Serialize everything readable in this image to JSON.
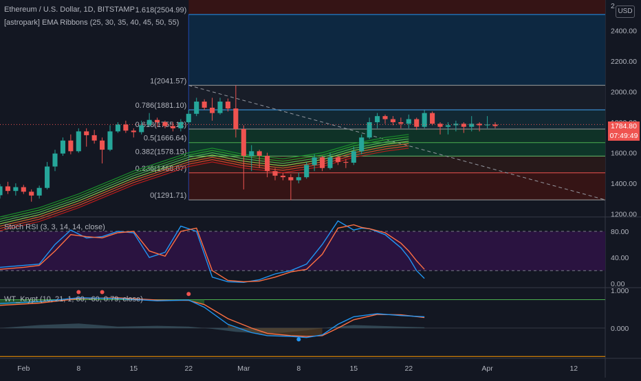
{
  "header": {
    "symbol_line": "Ethereum / U.S. Dollar, 1D, BITSTAMP",
    "ribbon_line": "[astropark] EMA Ribbons (25, 30, 35, 40, 45, 50, 55)",
    "stoch_line": "Stoch RSI (3, 3, 14, 14, close)",
    "wt_line": "WT_Krypt (10, 21, 1, 60, -60, 0.79, close)",
    "currency_button": "USD",
    "price_tag": "1784.80",
    "countdown_tag": "07:49:49",
    "top_partial_tick": "2"
  },
  "colors": {
    "bg": "#131722",
    "up": "#26a69a",
    "down": "#ef5350",
    "price_tag_bg": "#ef5350",
    "fib_border": "#2962ff",
    "stoch_k": "#2196f3",
    "stoch_d": "#ff7043",
    "stoch_band_fill": "#2a1340"
  },
  "chart_data": [
    {
      "type": "candlestick",
      "title": "Ethereum / U.S. Dollar, 1D, BITSTAMP",
      "ylim": [
        1180,
        2600
      ],
      "y_ticks": [
        "2400.00",
        "2200.00",
        "2000.00",
        "1800.00",
        "1600.00",
        "1400.00",
        "1200.00"
      ],
      "y_tick_values": [
        2400,
        2200,
        2000,
        1800,
        1600,
        1400,
        1200
      ],
      "x_ticks": [
        "Feb",
        "8",
        "15",
        "22",
        "Mar",
        "8",
        "15",
        "22",
        "Apr",
        "12"
      ],
      "x_tick_days": [
        0,
        7,
        14,
        21,
        28,
        35,
        42,
        49,
        59,
        70
      ],
      "x_range_days": [
        -3,
        74
      ],
      "candles_start_day": -3,
      "candles": [
        [
          1322,
          1380,
          1300,
          1395
        ],
        [
          1380,
          1350,
          1330,
          1410
        ],
        [
          1350,
          1375,
          1320,
          1400
        ],
        [
          1375,
          1345,
          1330,
          1390
        ],
        [
          1345,
          1320,
          1280,
          1360
        ],
        [
          1320,
          1370,
          1300,
          1385
        ],
        [
          1370,
          1510,
          1360,
          1540
        ],
        [
          1510,
          1595,
          1480,
          1620
        ],
        [
          1595,
          1680,
          1580,
          1700
        ],
        [
          1680,
          1610,
          1590,
          1720
        ],
        [
          1610,
          1740,
          1600,
          1760
        ],
        [
          1740,
          1715,
          1640,
          1760
        ],
        [
          1715,
          1680,
          1660,
          1750
        ],
        [
          1680,
          1620,
          1530,
          1700
        ],
        [
          1620,
          1740,
          1610,
          1780
        ],
        [
          1740,
          1785,
          1730,
          1800
        ],
        [
          1785,
          1745,
          1730,
          1810
        ],
        [
          1745,
          1735,
          1700,
          1760
        ],
        [
          1735,
          1780,
          1720,
          1810
        ],
        [
          1780,
          1815,
          1770,
          1860
        ],
        [
          1815,
          1800,
          1770,
          1830
        ],
        [
          1800,
          1775,
          1760,
          1810
        ],
        [
          1775,
          1760,
          1740,
          1800
        ],
        [
          1760,
          1800,
          1740,
          1820
        ],
        [
          1800,
          1855,
          1790,
          1880
        ],
        [
          1855,
          1935,
          1840,
          1960
        ],
        [
          1935,
          1895,
          1880,
          1950
        ],
        [
          1895,
          1860,
          1810,
          1960
        ],
        [
          1860,
          1935,
          1850,
          1960
        ],
        [
          1935,
          1890,
          1870,
          1955
        ],
        [
          1890,
          1755,
          1700,
          2041
        ],
        [
          1755,
          1580,
          1360,
          1780
        ],
        [
          1580,
          1610,
          1480,
          1650
        ],
        [
          1610,
          1580,
          1500,
          1620
        ],
        [
          1580,
          1480,
          1440,
          1600
        ],
        [
          1480,
          1450,
          1420,
          1500
        ],
        [
          1450,
          1440,
          1420,
          1470
        ],
        [
          1440,
          1420,
          1290,
          1460
        ],
        [
          1420,
          1440,
          1400,
          1470
        ],
        [
          1440,
          1520,
          1430,
          1540
        ],
        [
          1520,
          1570,
          1480,
          1590
        ],
        [
          1570,
          1500,
          1480,
          1580
        ],
        [
          1500,
          1570,
          1490,
          1600
        ],
        [
          1570,
          1540,
          1520,
          1580
        ],
        [
          1540,
          1535,
          1500,
          1560
        ],
        [
          1535,
          1610,
          1520,
          1640
        ],
        [
          1610,
          1700,
          1590,
          1720
        ],
        [
          1700,
          1800,
          1690,
          1830
        ],
        [
          1800,
          1840,
          1760,
          1860
        ],
        [
          1840,
          1820,
          1790,
          1850
        ],
        [
          1820,
          1800,
          1780,
          1840
        ],
        [
          1800,
          1790,
          1760,
          1830
        ],
        [
          1790,
          1820,
          1760,
          1850
        ],
        [
          1820,
          1770,
          1750,
          1830
        ],
        [
          1770,
          1860,
          1760,
          1880
        ],
        [
          1860,
          1790,
          1780,
          1870
        ],
        [
          1790,
          1770,
          1720,
          1800
        ],
        [
          1770,
          1780,
          1720,
          1800
        ],
        [
          1780,
          1790,
          1740,
          1810
        ],
        [
          1790,
          1770,
          1730,
          1800
        ],
        [
          1770,
          1790,
          1740,
          1840
        ],
        [
          1790,
          1780,
          1740,
          1800
        ],
        [
          1780,
          1785,
          1760,
          1840
        ],
        [
          1785,
          1775,
          1760,
          1800
        ]
      ],
      "candle_columns": [
        "open",
        "close",
        "low",
        "high"
      ],
      "current_price": 1784.8,
      "fib_levels": [
        {
          "ratio": "1.618",
          "value": 2504.99,
          "label": "1.618(2504.99)"
        },
        {
          "ratio": "1",
          "value": 2041.57,
          "label": "1(2041.57)"
        },
        {
          "ratio": "0.786",
          "value": 1881.1,
          "label": "0.786(1881.10)"
        },
        {
          "ratio": "0.618",
          "value": 1755.12,
          "label": "0.618(1755.12)"
        },
        {
          "ratio": "0.5",
          "value": 1666.64,
          "label": "0.5(1666.64)"
        },
        {
          "ratio": "0.382",
          "value": 1578.15,
          "label": "0.382(1578.15)"
        },
        {
          "ratio": "0.236",
          "value": 1468.67,
          "label": "0.236(1468.67)"
        },
        {
          "ratio": "0",
          "value": 1291.71,
          "label": "0(1291.71)"
        }
      ],
      "fib_range_days": [
        21,
        74
      ],
      "trendline": {
        "from": [
          21,
          2041.57
        ],
        "to": [
          74,
          1291.71
        ]
      },
      "ema_ribbon_basis": [
        [
          -3,
          1180
        ],
        [
          2,
          1240
        ],
        [
          7,
          1330
        ],
        [
          14,
          1480
        ],
        [
          21,
          1600
        ],
        [
          24,
          1630
        ],
        [
          28,
          1590
        ],
        [
          33,
          1560
        ],
        [
          38,
          1600
        ],
        [
          42,
          1660
        ],
        [
          46,
          1700
        ],
        [
          49,
          1720
        ]
      ],
      "ema_offsets": [
        0,
        -15,
        -30,
        -45,
        -60,
        -75,
        -90
      ],
      "ema_colors": [
        "#1b8e2d",
        "#2ca02c",
        "#4caf50",
        "#8bc34a",
        "#c8652b",
        "#d4442b",
        "#b71c1c"
      ]
    },
    {
      "type": "line",
      "title": "Stoch RSI (3, 3, 14, 14, close)",
      "ylim": [
        -5,
        100
      ],
      "y_ticks": [
        "80.00",
        "40.00",
        "0.00"
      ],
      "y_tick_values": [
        80,
        40,
        0
      ],
      "band": [
        20,
        80
      ],
      "series": [
        {
          "name": "K",
          "color": "#2196f3",
          "points": [
            [
              -3,
              25
            ],
            [
              0,
              28
            ],
            [
              2,
              30
            ],
            [
              4,
              60
            ],
            [
              6,
              82
            ],
            [
              8,
              70
            ],
            [
              10,
              72
            ],
            [
              12,
              80
            ],
            [
              14,
              78
            ],
            [
              16,
              40
            ],
            [
              18,
              48
            ],
            [
              20,
              88
            ],
            [
              22,
              80
            ],
            [
              24,
              10
            ],
            [
              26,
              3
            ],
            [
              28,
              2
            ],
            [
              30,
              6
            ],
            [
              32,
              15
            ],
            [
              34,
              20
            ],
            [
              36,
              30
            ],
            [
              38,
              60
            ],
            [
              40,
              96
            ],
            [
              42,
              82
            ],
            [
              43,
              85
            ],
            [
              44,
              84
            ],
            [
              46,
              75
            ],
            [
              48,
              55
            ],
            [
              49,
              40
            ],
            [
              50,
              20
            ],
            [
              51,
              8
            ]
          ]
        },
        {
          "name": "D",
          "color": "#ff7043",
          "points": [
            [
              -3,
              22
            ],
            [
              0,
              25
            ],
            [
              2,
              28
            ],
            [
              4,
              50
            ],
            [
              6,
              75
            ],
            [
              8,
              72
            ],
            [
              10,
              70
            ],
            [
              12,
              78
            ],
            [
              14,
              80
            ],
            [
              16,
              50
            ],
            [
              18,
              42
            ],
            [
              20,
              80
            ],
            [
              22,
              85
            ],
            [
              24,
              20
            ],
            [
              26,
              5
            ],
            [
              28,
              3
            ],
            [
              30,
              4
            ],
            [
              32,
              10
            ],
            [
              34,
              18
            ],
            [
              36,
              22
            ],
            [
              38,
              45
            ],
            [
              40,
              85
            ],
            [
              42,
              90
            ],
            [
              43,
              86
            ],
            [
              44,
              84
            ],
            [
              46,
              78
            ],
            [
              48,
              62
            ],
            [
              49,
              50
            ],
            [
              50,
              35
            ],
            [
              51,
              22
            ]
          ]
        }
      ]
    },
    {
      "type": "line",
      "title": "WT_Krypt (10, 21, 1, 60, -60, 0.79, close)",
      "ylim": [
        -0.8,
        1.05
      ],
      "y_ticks": [
        "1.000",
        "0.000"
      ],
      "y_tick_values": [
        1,
        0
      ],
      "levels": [
        0.75,
        -0.75
      ],
      "series": [
        {
          "name": "wt1",
          "color": "#2196f3",
          "points": [
            [
              -3,
              0.65
            ],
            [
              2,
              0.7
            ],
            [
              7,
              0.8
            ],
            [
              12,
              0.78
            ],
            [
              17,
              0.72
            ],
            [
              21,
              0.74
            ],
            [
              23,
              0.55
            ],
            [
              26,
              0.1
            ],
            [
              29,
              -0.12
            ],
            [
              31,
              -0.2
            ],
            [
              34,
              -0.22
            ],
            [
              36,
              -0.25
            ],
            [
              38,
              -0.18
            ],
            [
              40,
              0.1
            ],
            [
              42,
              0.3
            ],
            [
              45,
              0.38
            ],
            [
              48,
              0.33
            ],
            [
              51,
              0.3
            ]
          ]
        },
        {
          "name": "wt2",
          "color": "#ff7043",
          "points": [
            [
              -3,
              0.6
            ],
            [
              2,
              0.66
            ],
            [
              7,
              0.78
            ],
            [
              12,
              0.8
            ],
            [
              17,
              0.74
            ],
            [
              21,
              0.73
            ],
            [
              23,
              0.62
            ],
            [
              26,
              0.25
            ],
            [
              29,
              0.0
            ],
            [
              31,
              -0.14
            ],
            [
              34,
              -0.2
            ],
            [
              36,
              -0.22
            ],
            [
              38,
              -0.2
            ],
            [
              40,
              0.0
            ],
            [
              42,
              0.22
            ],
            [
              45,
              0.36
            ],
            [
              48,
              0.35
            ],
            [
              51,
              0.28
            ]
          ]
        },
        {
          "name": "histogram",
          "color": "#4a6a7a",
          "points": [
            [
              -3,
              0.0
            ],
            [
              2,
              0.08
            ],
            [
              7,
              0.12
            ],
            [
              12,
              0.04
            ],
            [
              17,
              0.06
            ],
            [
              21,
              0.04
            ],
            [
              24,
              -0.02
            ],
            [
              27,
              -0.1
            ],
            [
              30,
              -0.14
            ],
            [
              33,
              -0.12
            ],
            [
              36,
              -0.06
            ],
            [
              39,
              0.02
            ],
            [
              42,
              0.08
            ],
            [
              45,
              0.06
            ],
            [
              48,
              0.04
            ],
            [
              51,
              0.02
            ]
          ]
        }
      ],
      "dots": [
        {
          "day": 7,
          "value": 0.95,
          "color": "#ef5350"
        },
        {
          "day": 10,
          "value": 0.95,
          "color": "#ef5350"
        },
        {
          "day": 21,
          "value": 0.9,
          "color": "#ef5350"
        },
        {
          "day": 35,
          "value": -0.3,
          "color": "#2196f3"
        }
      ]
    }
  ]
}
